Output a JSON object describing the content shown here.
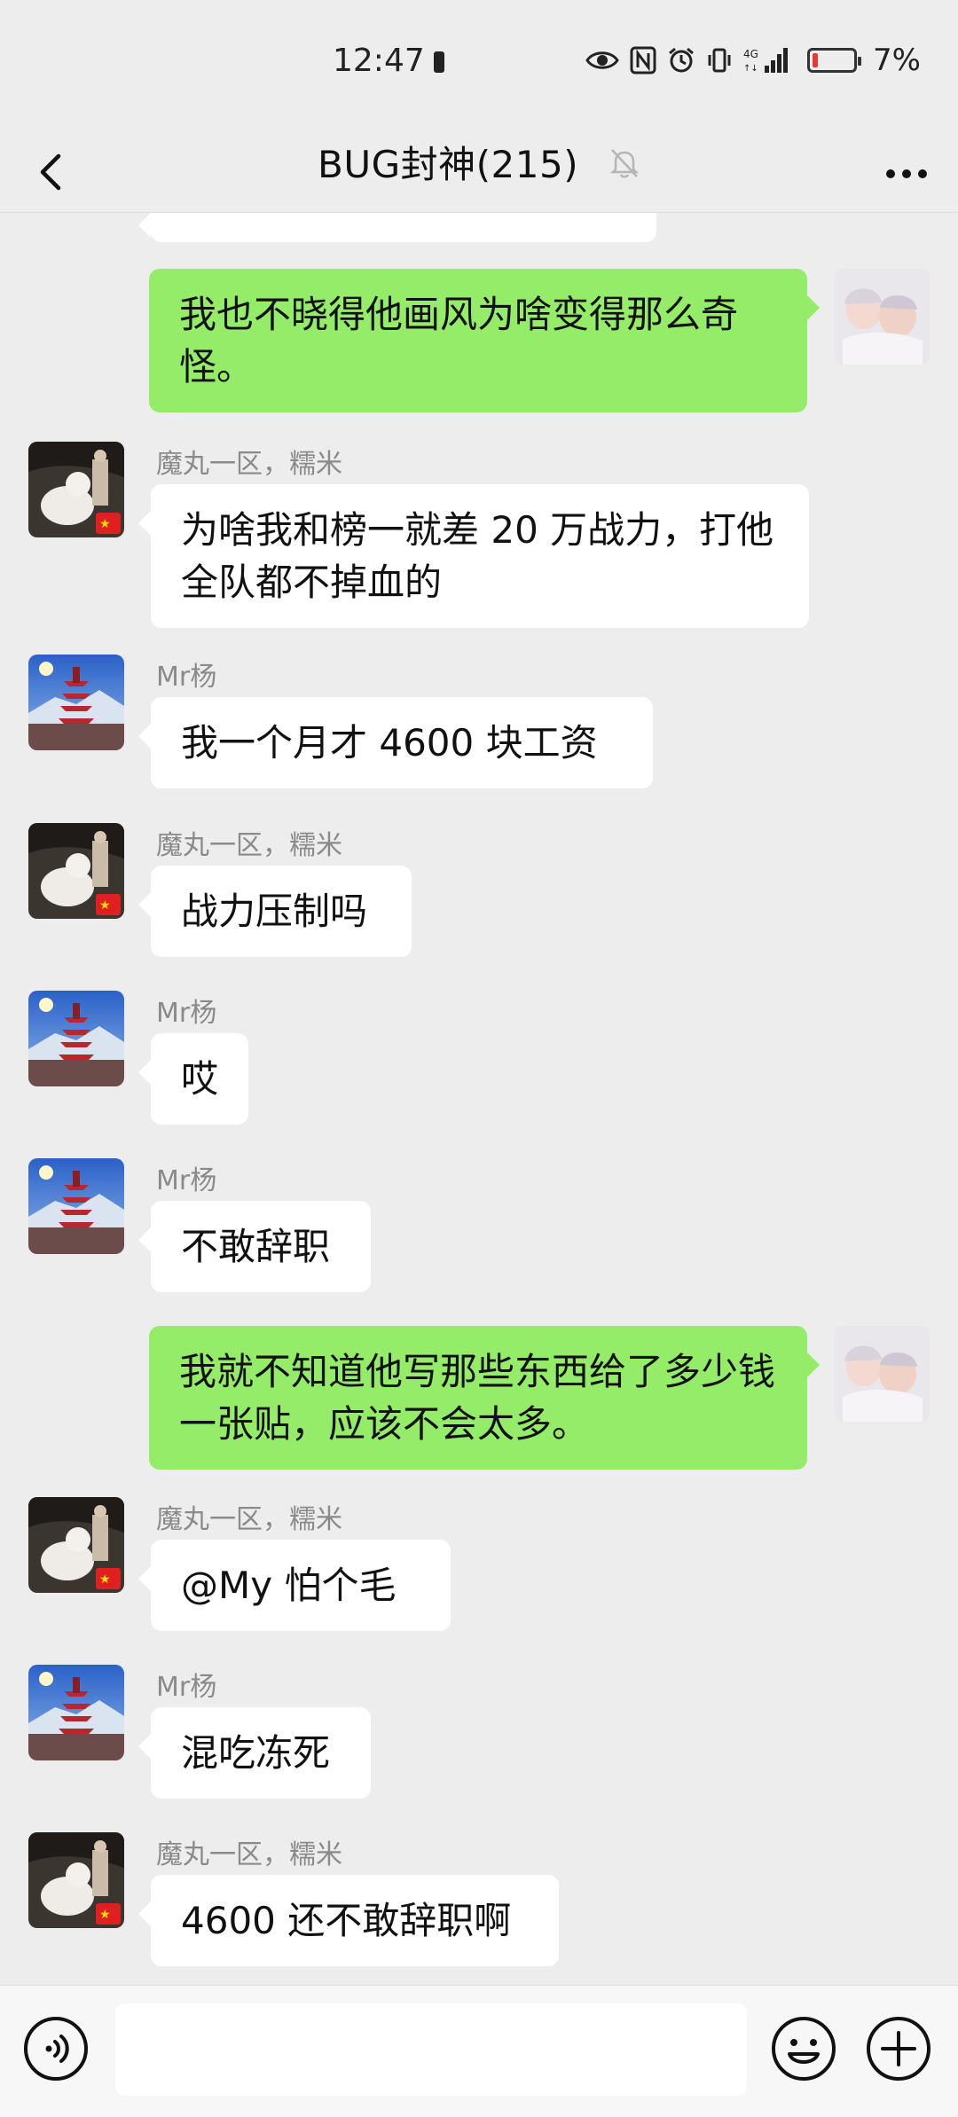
{
  "status": {
    "time": "12:47",
    "network": "4G",
    "battery": "7%"
  },
  "nav": {
    "title": "BUG封神(215)"
  },
  "messages": [
    {
      "side": "left",
      "sender": "魔丸一区，糯米",
      "avatar": "white-dog-avatar",
      "text": "为啥我和榜一就差 20 万战力，打他全队都不掉血的"
    },
    {
      "side": "left",
      "sender": "Mr杨",
      "avatar": "pagoda-avatar",
      "text": "我一个月才 4600 块工资"
    },
    {
      "side": "left",
      "sender": "魔丸一区，糯米",
      "avatar": "white-dog-avatar",
      "text": "战力压制吗"
    },
    {
      "side": "left",
      "sender": "Mr杨",
      "avatar": "pagoda-avatar",
      "text": "哎"
    },
    {
      "side": "left",
      "sender": "Mr杨",
      "avatar": "pagoda-avatar",
      "text": "不敢辞职"
    },
    {
      "side": "right",
      "avatar": "twin-babies-avatar",
      "text": "我就不知道他写那些东西给了多少钱一张贴，应该不会太多。"
    },
    {
      "side": "left",
      "sender": "魔丸一区，糯米",
      "avatar": "white-dog-avatar",
      "text": "@My  怕个毛"
    },
    {
      "side": "left",
      "sender": "Mr杨",
      "avatar": "pagoda-avatar",
      "text": "混吃冻死"
    },
    {
      "side": "left",
      "sender": "魔丸一区，糯米",
      "avatar": "white-dog-avatar",
      "text": "4600 还不敢辞职啊"
    }
  ],
  "first_right": {
    "text": "我也不晓得他画风为啥变得那么奇怪。"
  },
  "colors": {
    "own_bubble": "#95ec69",
    "other_bubble": "#ffffff",
    "background": "#ededed"
  }
}
